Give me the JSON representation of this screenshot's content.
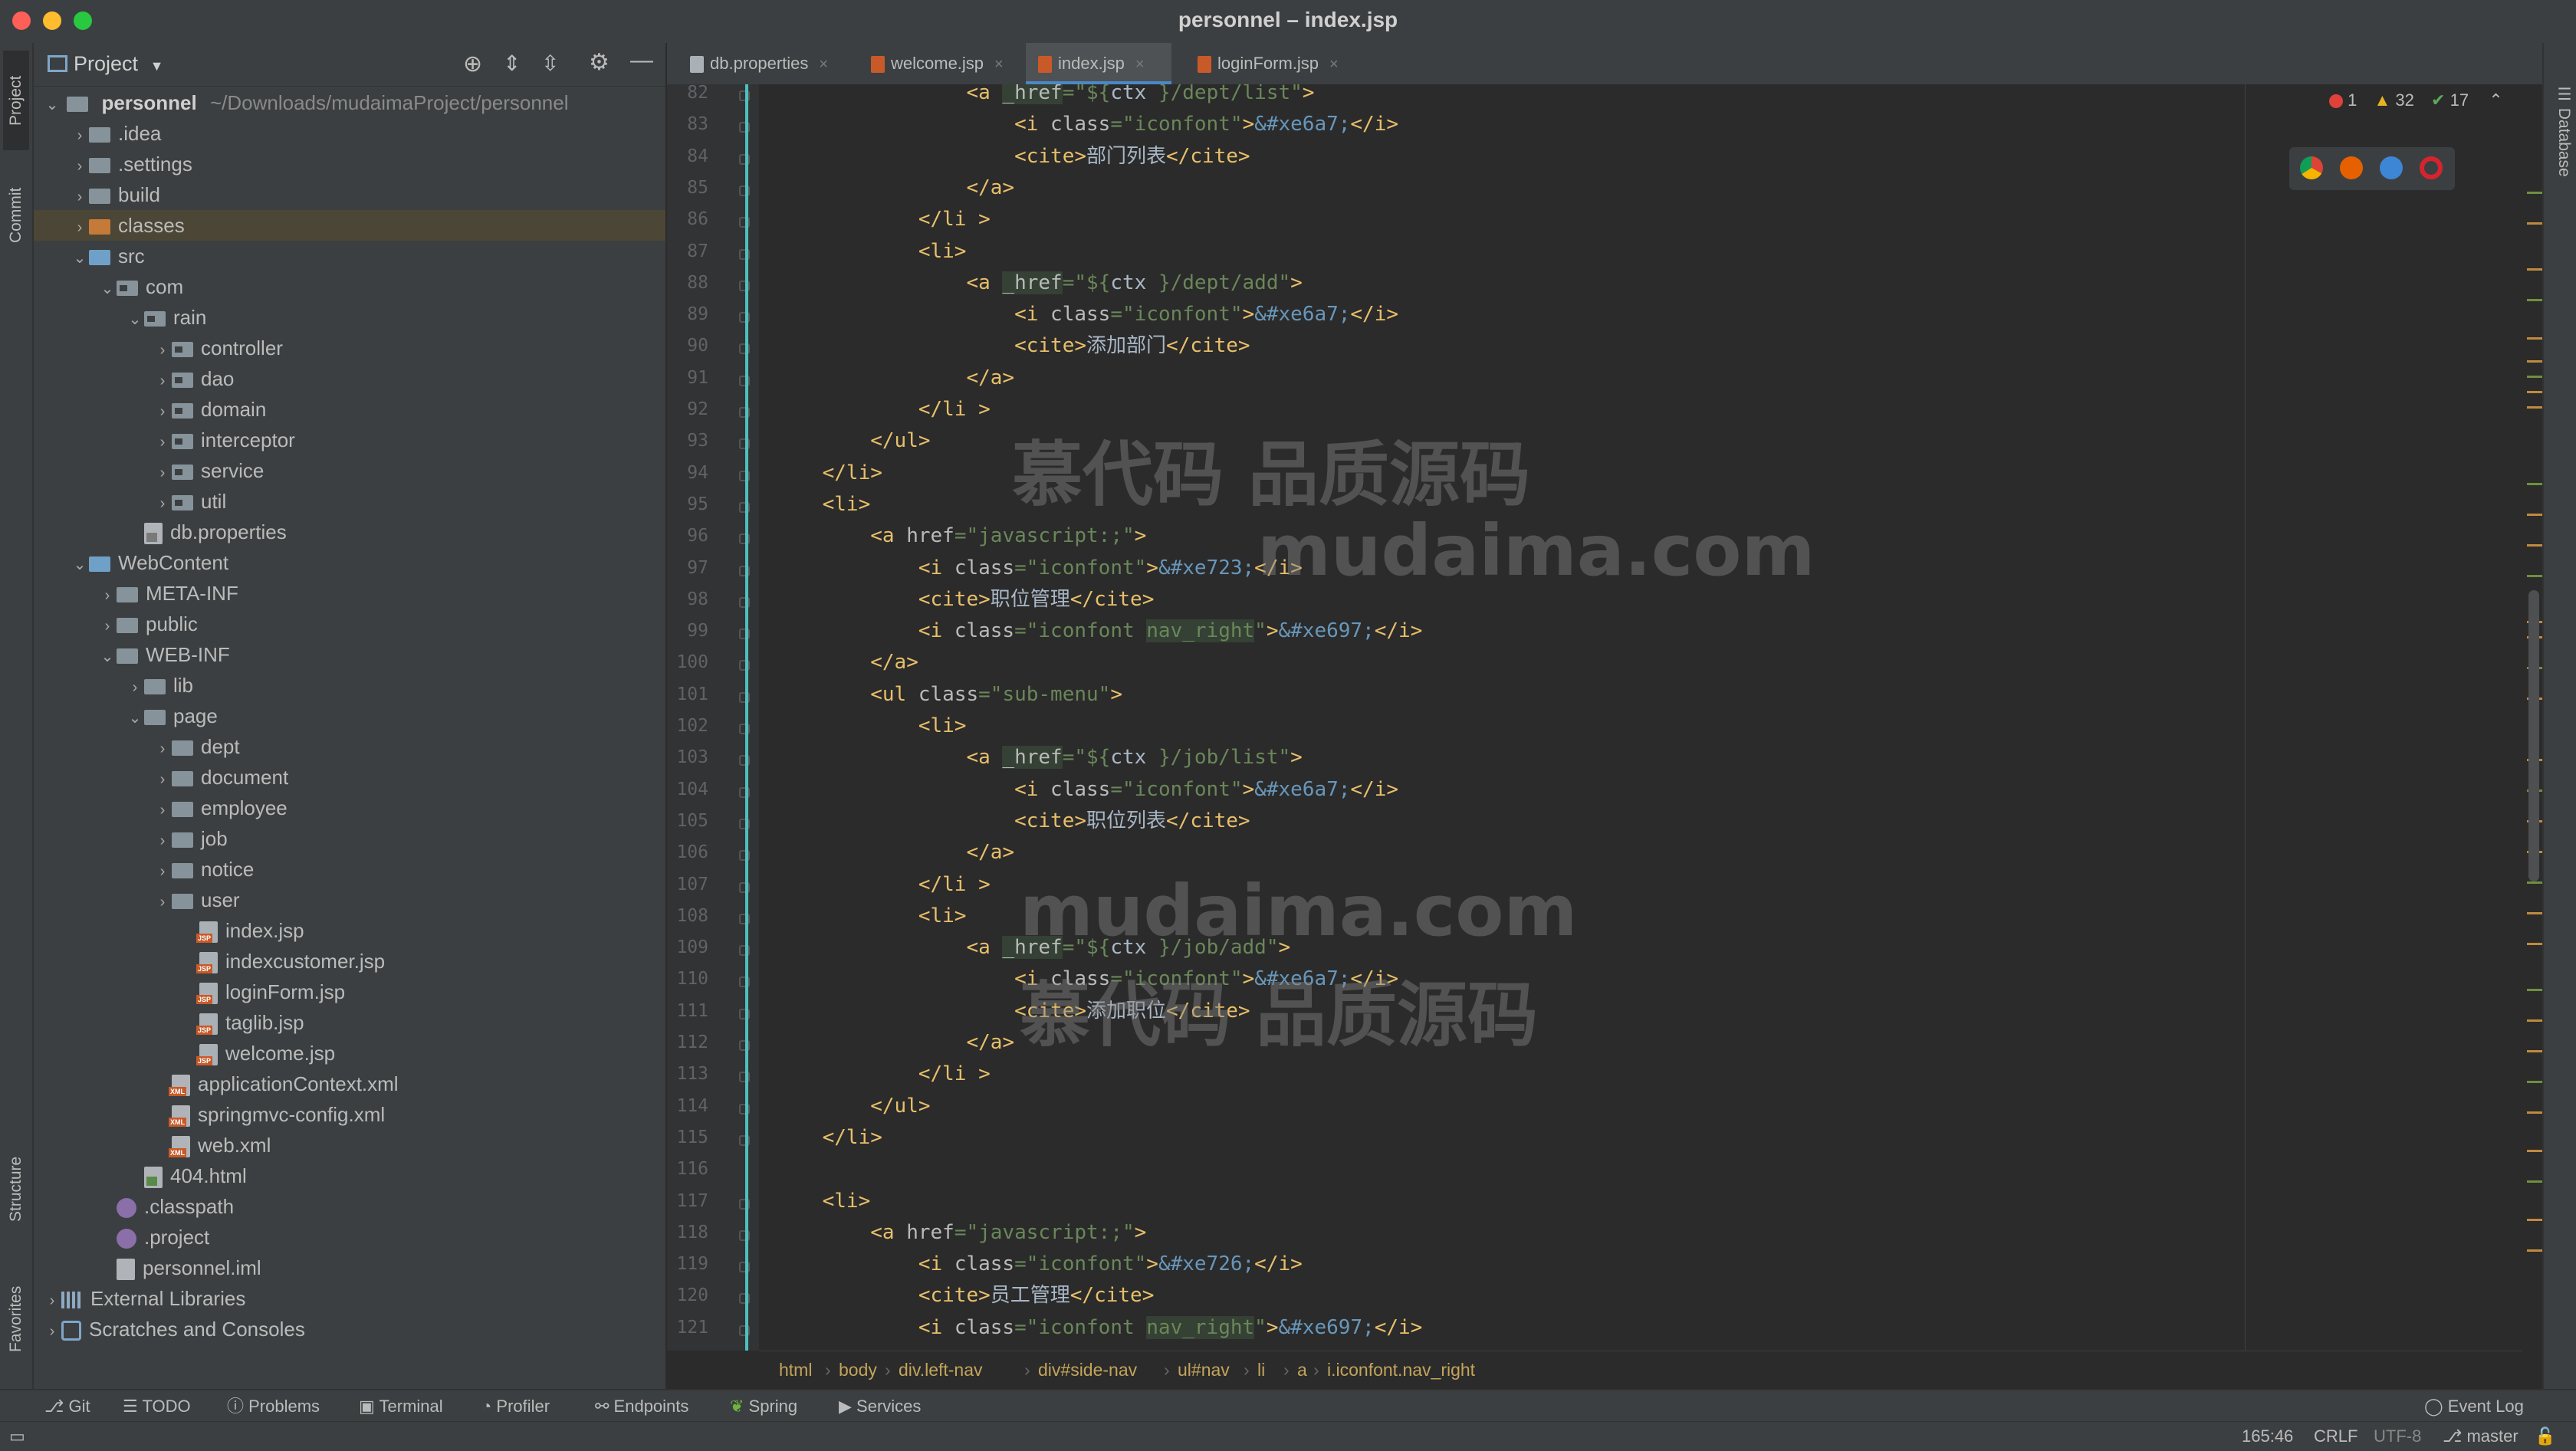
{
  "window": {
    "title": "personnel – index.jsp"
  },
  "left_stripe": {
    "project": "Project",
    "commit": "Commit",
    "structure": "Structure",
    "favorites": "Favorites"
  },
  "right_stripe": {
    "database": "Database"
  },
  "project_panel": {
    "title": "Project",
    "root_name": "personnel",
    "root_path": "~/Downloads/mudaimaProject/personnel",
    "items": [
      {
        "label": ".idea"
      },
      {
        "label": ".settings"
      },
      {
        "label": "build"
      },
      {
        "label": "classes"
      },
      {
        "label": "src"
      },
      {
        "label": "com"
      },
      {
        "label": "rain"
      },
      {
        "label": "controller"
      },
      {
        "label": "dao"
      },
      {
        "label": "domain"
      },
      {
        "label": "interceptor"
      },
      {
        "label": "service"
      },
      {
        "label": "util"
      },
      {
        "label": "db.properties"
      },
      {
        "label": "WebContent"
      },
      {
        "label": "META-INF"
      },
      {
        "label": "public"
      },
      {
        "label": "WEB-INF"
      },
      {
        "label": "lib"
      },
      {
        "label": "page"
      },
      {
        "label": "dept"
      },
      {
        "label": "document"
      },
      {
        "label": "employee"
      },
      {
        "label": "job"
      },
      {
        "label": "notice"
      },
      {
        "label": "user"
      },
      {
        "label": "index.jsp"
      },
      {
        "label": "indexcustomer.jsp"
      },
      {
        "label": "loginForm.jsp"
      },
      {
        "label": "taglib.jsp"
      },
      {
        "label": "welcome.jsp"
      },
      {
        "label": "applicationContext.xml"
      },
      {
        "label": "springmvc-config.xml"
      },
      {
        "label": "web.xml"
      },
      {
        "label": "404.html"
      },
      {
        "label": ".classpath"
      },
      {
        "label": ".project"
      },
      {
        "label": "personnel.iml"
      },
      {
        "label": "External Libraries"
      },
      {
        "label": "Scratches and Consoles"
      }
    ]
  },
  "tabs": [
    {
      "label": "db.properties"
    },
    {
      "label": "welcome.jsp"
    },
    {
      "label": "index.jsp"
    },
    {
      "label": "loginForm.jsp"
    }
  ],
  "inspections": {
    "errors": "1",
    "warnings": "32",
    "ok": "17"
  },
  "code_lines": [
    {
      "n": "82",
      "html": "                <span class=\"t\">&lt;a </span><span class=\"a hl\">_href</span><span class=\"s\">=\"${</span><span class=\"x\">ctx </span><span class=\"s\">}/dept/list\"</span><span class=\"t\">&gt;</span>"
    },
    {
      "n": "83",
      "html": "                    <span class=\"t\">&lt;i </span><span class=\"a\">class</span><span class=\"s\">=\"iconfont\"</span><span class=\"t\">&gt;</span><span class=\"e\">&amp;#xe6a7;</span><span class=\"t\">&lt;/i&gt;</span>"
    },
    {
      "n": "84",
      "html": "                    <span class=\"t\">&lt;cite&gt;</span><span class=\"x\">部门列表</span><span class=\"t\">&lt;/cite&gt;</span>"
    },
    {
      "n": "85",
      "html": "                <span class=\"t\">&lt;/a&gt;</span>"
    },
    {
      "n": "86",
      "html": "            <span class=\"t\">&lt;/li &gt;</span>"
    },
    {
      "n": "87",
      "html": "            <span class=\"t\">&lt;li&gt;</span>"
    },
    {
      "n": "88",
      "html": "                <span class=\"t\">&lt;a </span><span class=\"a hl\">_href</span><span class=\"s\">=\"${</span><span class=\"x\">ctx </span><span class=\"s\">}/dept/add\"</span><span class=\"t\">&gt;</span>"
    },
    {
      "n": "89",
      "html": "                    <span class=\"t\">&lt;i </span><span class=\"a\">class</span><span class=\"s\">=\"iconfont\"</span><span class=\"t\">&gt;</span><span class=\"e\">&amp;#xe6a7;</span><span class=\"t\">&lt;/i&gt;</span>"
    },
    {
      "n": "90",
      "html": "                    <span class=\"t\">&lt;cite&gt;</span><span class=\"x\">添加部门</span><span class=\"t\">&lt;/cite&gt;</span>"
    },
    {
      "n": "91",
      "html": "                <span class=\"t\">&lt;/a&gt;</span>"
    },
    {
      "n": "92",
      "html": "            <span class=\"t\">&lt;/li &gt;</span>"
    },
    {
      "n": "93",
      "html": "        <span class=\"t\">&lt;/ul&gt;</span>"
    },
    {
      "n": "94",
      "html": "    <span class=\"t\">&lt;/li&gt;</span>"
    },
    {
      "n": "95",
      "html": "    <span class=\"t\">&lt;li&gt;</span>"
    },
    {
      "n": "96",
      "html": "        <span class=\"t\">&lt;a </span><span class=\"a\">href</span><span class=\"s\">=\"javascript:;\"</span><span class=\"t\">&gt;</span>"
    },
    {
      "n": "97",
      "html": "            <span class=\"t\">&lt;i </span><span class=\"a\">class</span><span class=\"s\">=\"iconfont\"</span><span class=\"t\">&gt;</span><span class=\"e\">&amp;#xe723;</span><span class=\"t\">&lt;/i&gt;</span>"
    },
    {
      "n": "98",
      "html": "            <span class=\"t\">&lt;cite&gt;</span><span class=\"x\">职位管理</span><span class=\"t\">&lt;/cite&gt;</span>"
    },
    {
      "n": "99",
      "html": "            <span class=\"t\">&lt;i </span><span class=\"a\">class</span><span class=\"s\">=\"iconfont </span><span class=\"s hl\">nav_right</span><span class=\"s\">\"</span><span class=\"t\">&gt;</span><span class=\"e\">&amp;#xe697;</span><span class=\"t\">&lt;/i&gt;</span>"
    },
    {
      "n": "100",
      "html": "        <span class=\"t\">&lt;/a&gt;</span>"
    },
    {
      "n": "101",
      "html": "        <span class=\"t\">&lt;ul </span><span class=\"a\">class</span><span class=\"s\">=\"sub-menu\"</span><span class=\"t\">&gt;</span>"
    },
    {
      "n": "102",
      "html": "            <span class=\"t\">&lt;li&gt;</span>"
    },
    {
      "n": "103",
      "html": "                <span class=\"t\">&lt;a </span><span class=\"a hl\">_href</span><span class=\"s\">=\"${</span><span class=\"x\">ctx </span><span class=\"s\">}/job/list\"</span><span class=\"t\">&gt;</span>"
    },
    {
      "n": "104",
      "html": "                    <span class=\"t\">&lt;i </span><span class=\"a\">class</span><span class=\"s\">=\"iconfont\"</span><span class=\"t\">&gt;</span><span class=\"e\">&amp;#xe6a7;</span><span class=\"t\">&lt;/i&gt;</span>"
    },
    {
      "n": "105",
      "html": "                    <span class=\"t\">&lt;cite&gt;</span><span class=\"x\">职位列表</span><span class=\"t\">&lt;/cite&gt;</span>"
    },
    {
      "n": "106",
      "html": "                <span class=\"t\">&lt;/a&gt;</span>"
    },
    {
      "n": "107",
      "html": "            <span class=\"t\">&lt;/li &gt;</span>"
    },
    {
      "n": "108",
      "html": "            <span class=\"t\">&lt;li&gt;</span>"
    },
    {
      "n": "109",
      "html": "                <span class=\"t\">&lt;a </span><span class=\"a hl\">_href</span><span class=\"s\">=\"${</span><span class=\"x\">ctx </span><span class=\"s\">}/job/add\"</span><span class=\"t\">&gt;</span>"
    },
    {
      "n": "110",
      "html": "                    <span class=\"t\">&lt;i </span><span class=\"a\">class</span><span class=\"s\">=\"iconfont\"</span><span class=\"t\">&gt;</span><span class=\"e\">&amp;#xe6a7;</span><span class=\"t\">&lt;/i&gt;</span>"
    },
    {
      "n": "111",
      "html": "                    <span class=\"t\">&lt;cite&gt;</span><span class=\"x\">添加职位</span><span class=\"t\">&lt;/cite&gt;</span>"
    },
    {
      "n": "112",
      "html": "                <span class=\"t\">&lt;/a&gt;</span>"
    },
    {
      "n": "113",
      "html": "            <span class=\"t\">&lt;/li &gt;</span>"
    },
    {
      "n": "114",
      "html": "        <span class=\"t\">&lt;/ul&gt;</span>"
    },
    {
      "n": "115",
      "html": "    <span class=\"t\">&lt;/li&gt;</span>"
    },
    {
      "n": "116",
      "html": ""
    },
    {
      "n": "117",
      "html": "    <span class=\"t\">&lt;li&gt;</span>"
    },
    {
      "n": "118",
      "html": "        <span class=\"t\">&lt;a </span><span class=\"a\">href</span><span class=\"s\">=\"javascript:;\"</span><span class=\"t\">&gt;</span>"
    },
    {
      "n": "119",
      "html": "            <span class=\"t\">&lt;i </span><span class=\"a\">class</span><span class=\"s\">=\"iconfont\"</span><span class=\"t\">&gt;</span><span class=\"e\">&amp;#xe726;</span><span class=\"t\">&lt;/i&gt;</span>"
    },
    {
      "n": "120",
      "html": "            <span class=\"t\">&lt;cite&gt;</span><span class=\"x\">员工管理</span><span class=\"t\">&lt;/cite&gt;</span>"
    },
    {
      "n": "121",
      "html": "            <span class=\"t\">&lt;i </span><span class=\"a\">class</span><span class=\"s\">=\"iconfont </span><span class=\"s hl\">nav_right</span><span class=\"s\">\"</span><span class=\"t\">&gt;</span><span class=\"e\">&amp;#xe697;</span><span class=\"t\">&lt;/i&gt;</span>"
    }
  ],
  "watermarks": [
    "慕代码 品质源码",
    "mudaima.com",
    "mudaima.com",
    "慕代码 品质源码"
  ],
  "breadcrumb": [
    "html",
    "body",
    "div.left-nav",
    "div#side-nav",
    "ul#nav",
    "li",
    "a",
    "i.iconfont.nav_right"
  ],
  "bottom_tools": [
    "Git",
    "TODO",
    "Problems",
    "Terminal",
    "Profiler",
    "Endpoints",
    "Spring",
    "Services"
  ],
  "event_log": "Event Log",
  "status": {
    "position": "165:46",
    "line_sep": "CRLF",
    "encoding": "UTF-8",
    "branch": "master"
  },
  "colors": {
    "accent": "#4a88c7",
    "selection": "#4b4636",
    "guide": "#4fbfbf"
  }
}
